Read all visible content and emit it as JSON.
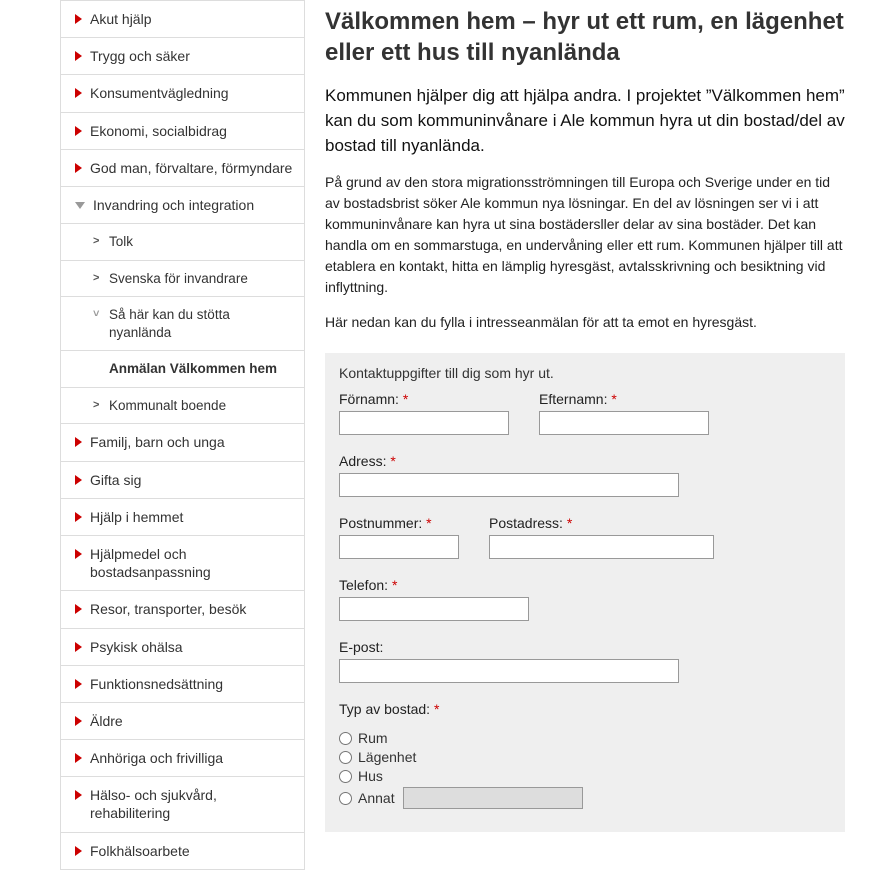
{
  "sidebar": {
    "items": [
      {
        "label": "Akut hjälp",
        "level": 1,
        "icon": "arrow"
      },
      {
        "label": "Trygg och säker",
        "level": 1,
        "icon": "arrow"
      },
      {
        "label": "Konsumentvägledning",
        "level": 1,
        "icon": "arrow"
      },
      {
        "label": "Ekonomi, socialbidrag",
        "level": 1,
        "icon": "arrow"
      },
      {
        "label": "God man, förvaltare, förmyndare",
        "level": 1,
        "icon": "arrow"
      },
      {
        "label": "Invandring och integration",
        "level": 1,
        "icon": "arrow-open"
      },
      {
        "label": "Tolk",
        "level": 2,
        "icon": "chev"
      },
      {
        "label": "Svenska för invandrare",
        "level": 2,
        "icon": "chev"
      },
      {
        "label": "Så här kan du stötta nyanlända",
        "level": 2,
        "icon": "chev-open"
      },
      {
        "label": "Anmälan Välkommen hem",
        "level": 3,
        "icon": "none",
        "active": true
      },
      {
        "label": "Kommunalt boende",
        "level": 2,
        "icon": "chev"
      },
      {
        "label": "Familj, barn och unga",
        "level": 1,
        "icon": "arrow"
      },
      {
        "label": "Gifta sig",
        "level": 1,
        "icon": "arrow"
      },
      {
        "label": "Hjälp i hemmet",
        "level": 1,
        "icon": "arrow"
      },
      {
        "label": "Hjälpmedel och bostadsanpassning",
        "level": 1,
        "icon": "arrow"
      },
      {
        "label": "Resor, transporter, besök",
        "level": 1,
        "icon": "arrow"
      },
      {
        "label": "Psykisk ohälsa",
        "level": 1,
        "icon": "arrow"
      },
      {
        "label": "Funktionsnedsättning",
        "level": 1,
        "icon": "arrow"
      },
      {
        "label": "Äldre",
        "level": 1,
        "icon": "arrow"
      },
      {
        "label": "Anhöriga och frivilliga",
        "level": 1,
        "icon": "arrow"
      },
      {
        "label": "Hälso- och sjukvård, rehabilitering",
        "level": 1,
        "icon": "arrow"
      },
      {
        "label": "Folkhälsoarbete",
        "level": 1,
        "icon": "arrow"
      }
    ]
  },
  "page": {
    "title": "Välkommen hem – hyr ut ett rum, en lägenhet eller ett hus till nyanlända",
    "intro": "Kommunen hjälper dig att hjälpa andra. I projektet ”Välkommen hem” kan du som kommuninvånare i Ale kommun hyra ut din bostad/del av bostad till nyanlända.",
    "p1": "På grund av den stora migrationsströmningen till Europa och Sverige under en tid av bostadsbrist söker Ale kommun nya lösningar. En del av lösningen ser vi i att kommuninvånare kan hyra ut sina bostädersller delar av sina bostäder. Det kan handla om en sommarstuga, en undervåning eller ett rum. Kommunen hjälper till att etablera en kontakt, hitta en lämplig hyresgäst, avtalsskrivning och besiktning vid inflyttning.",
    "p2": "Här nedan kan du fylla i intresseanmälan för att ta emot en hyresgäst."
  },
  "form": {
    "legend": "Kontaktuppgifter till dig som hyr ut.",
    "required_marker": "*",
    "fields": {
      "firstname_label": "Förnamn:",
      "lastname_label": "Efternamn:",
      "address_label": "Adress:",
      "postcode_label": "Postnummer:",
      "postaddr_label": "Postadress:",
      "phone_label": "Telefon:",
      "email_label": "E-post:",
      "housing_label": "Typ av bostad:"
    },
    "housing": {
      "options": [
        {
          "label": "Rum"
        },
        {
          "label": "Lägenhet"
        },
        {
          "label": "Hus"
        },
        {
          "label": "Annat",
          "other": true
        }
      ]
    }
  }
}
